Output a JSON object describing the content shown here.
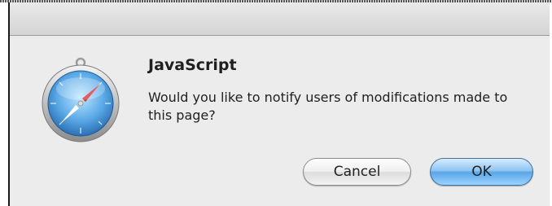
{
  "dialog": {
    "title": "JavaScript",
    "message": "Would you like to notify users of modifications made to this page?",
    "icon": "safari-compass-icon",
    "buttons": {
      "cancel_label": "Cancel",
      "ok_label": "OK"
    },
    "colors": {
      "default_button": "#5aa6e8",
      "background": "#ececec"
    }
  }
}
